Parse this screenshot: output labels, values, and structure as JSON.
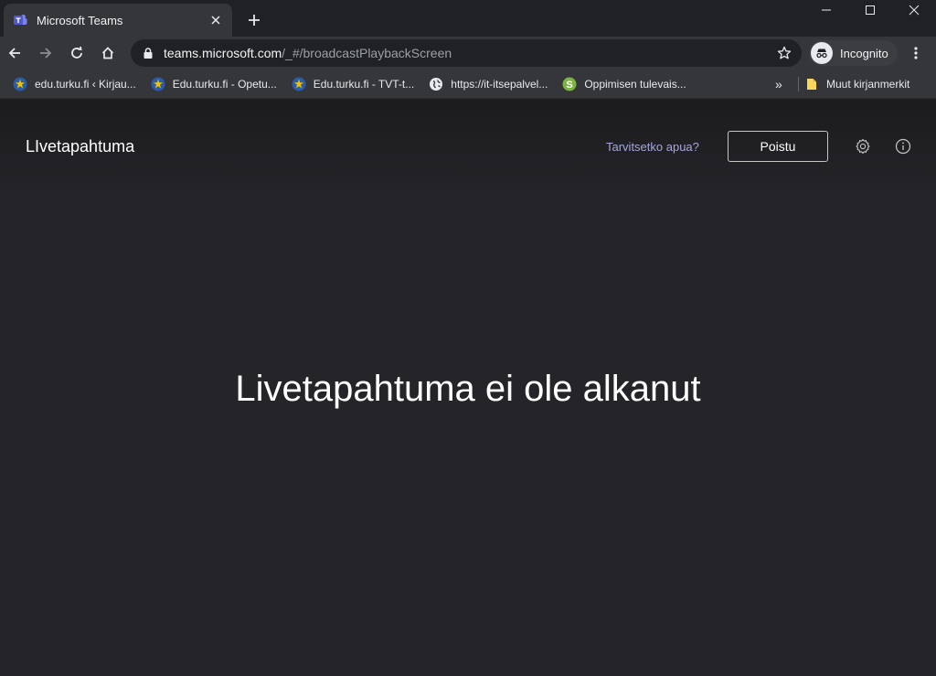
{
  "browser": {
    "tab": {
      "title": "Microsoft Teams",
      "favicon": "teams-icon"
    },
    "url": {
      "host": "teams.microsoft.com",
      "path": "/_#/broadcastPlaybackScreen"
    },
    "incognito_label": "Incognito",
    "bookmarks": [
      {
        "label": "edu.turku.fi ‹ Kirjau...",
        "icon": "turku-icon"
      },
      {
        "label": "Edu.turku.fi - Opetu...",
        "icon": "turku-icon"
      },
      {
        "label": "Edu.turku.fi - TVT-t...",
        "icon": "turku-icon"
      },
      {
        "label": "https://it-itsepalvel...",
        "icon": "globe-icon"
      },
      {
        "label": "Oppimisen tulevais...",
        "icon": "s-icon"
      }
    ],
    "bookmarks_more": "»",
    "other_bookmarks": "Muut kirjanmerkit"
  },
  "teams": {
    "title": "LIvetapahtuma",
    "help_link": "Tarvitsetko apua?",
    "leave_button": "Poistu",
    "status_message": "Livetapahtuma ei ole alkanut"
  },
  "colors": {
    "page_background": "#252428",
    "accent_link": "#a6a7dc"
  }
}
